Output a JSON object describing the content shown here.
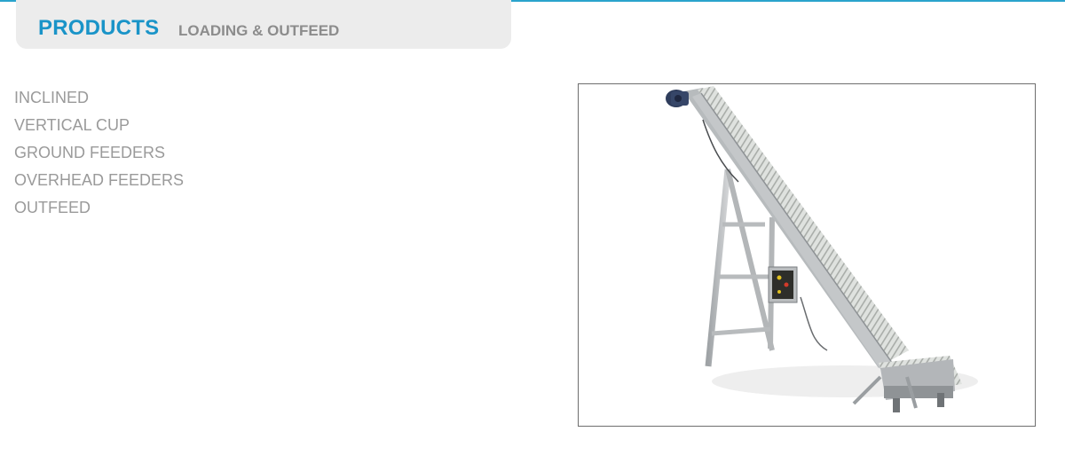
{
  "header": {
    "title": "PRODUCTS",
    "subtitle": "LOADING & OUTFEED"
  },
  "nav": {
    "items": [
      {
        "label": "INCLINED"
      },
      {
        "label": "VERTICAL CUP"
      },
      {
        "label": "GROUND FEEDERS"
      },
      {
        "label": "OVERHEAD FEEDERS"
      },
      {
        "label": "OUTFEED"
      }
    ]
  },
  "product_image": {
    "subject": "inclined-conveyor"
  },
  "colors": {
    "accent": "#1a94c8",
    "top_rule": "#2aa3cc",
    "header_bg": "#ececec",
    "subtitle": "#8c8c8c",
    "nav_text": "#9a9a9a",
    "frame_border": "#6e6e6e"
  }
}
